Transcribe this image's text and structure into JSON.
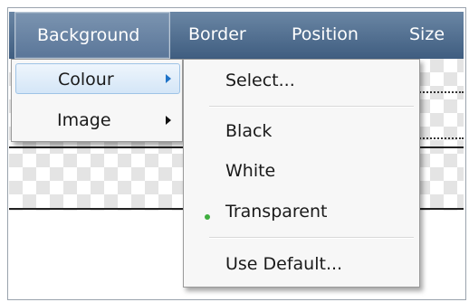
{
  "menubar": {
    "items": [
      {
        "label": "Background",
        "active": true
      },
      {
        "label": "Border",
        "active": false
      },
      {
        "label": "Position",
        "active": false
      },
      {
        "label": "Size",
        "active": false
      }
    ]
  },
  "background_menu": {
    "items": [
      {
        "label": "Colour",
        "has_submenu": true,
        "highlighted": true
      },
      {
        "label": "Image",
        "has_submenu": true,
        "highlighted": false
      }
    ]
  },
  "colour_submenu": {
    "items": [
      {
        "label": "Select...",
        "selected": false
      },
      {
        "label": "Black",
        "selected": false
      },
      {
        "label": "White",
        "selected": false
      },
      {
        "label": "Transparent",
        "selected": true
      },
      {
        "label": "Use Default...",
        "selected": false
      }
    ]
  },
  "colors": {
    "menubar": "#4f6d90",
    "selected_bullet": "#3fae3f",
    "highlight_border": "#9ec3e6",
    "submenu_arrow_active": "#1e73c8"
  }
}
